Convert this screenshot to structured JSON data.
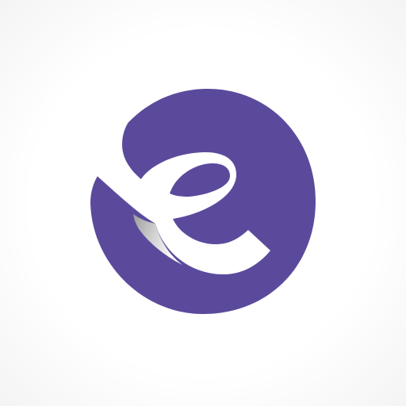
{
  "app_icon": {
    "icon_name": "swirl-e-logo-icon",
    "colors": {
      "background": "#ffffff",
      "circle": "#5b4a9c",
      "letter": "#ffffff",
      "fold_shadow": "#c9c9c9"
    }
  }
}
